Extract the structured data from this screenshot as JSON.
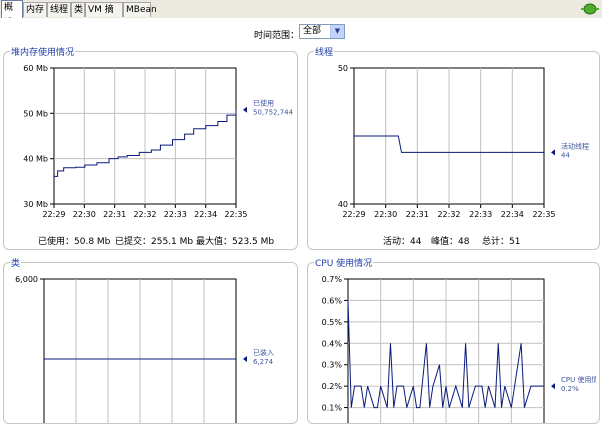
{
  "tabs": [
    {
      "label": "概述",
      "active": true
    },
    {
      "label": "内存"
    },
    {
      "label": "线程"
    },
    {
      "label": "类"
    },
    {
      "label": "VM 摘要"
    },
    {
      "label": "MBean"
    }
  ],
  "time_range": {
    "label": "时间范围：",
    "value": "全部"
  },
  "panels": {
    "heap": {
      "title": "堆内存使用情况",
      "legend": [
        "已使用",
        "50,752,744"
      ],
      "footer": {
        "used": "已使用：50.8 Mb",
        "committed": "已提交：255.1 Mb",
        "max": "最大值：523.5 Mb"
      }
    },
    "threads": {
      "title": "线程",
      "legend": [
        "活动线程",
        "44"
      ],
      "footer": {
        "live": "活动：44",
        "peak": "峰值：48",
        "total": "总计：51"
      }
    },
    "classes": {
      "title": "类",
      "legend": [
        "已装入",
        "6,274"
      ]
    },
    "cpu": {
      "title": "CPU 使用情况",
      "legend": [
        "CPU 使用情况",
        "0.2%"
      ]
    }
  },
  "colors": {
    "series": "#0a1a7a",
    "grid": "#c0c0c0",
    "title": "#1f3da8"
  },
  "chart_data": [
    {
      "type": "line",
      "title": "堆内存使用情况",
      "x": [
        "22:29",
        "22:30",
        "22:31",
        "22:32",
        "22:33",
        "22:34",
        "22:35"
      ],
      "yticks": [
        "30 Mb",
        "40 Mb",
        "50 Mb",
        "60 Mb"
      ],
      "ylim": [
        30,
        60
      ],
      "xlim": [
        22.48,
        28.5
      ],
      "series": [
        {
          "name": "已使用",
          "points": [
            [
              22.48,
              36.1
            ],
            [
              22.6,
              37.3
            ],
            [
              22.8,
              38.0
            ],
            [
              23.2,
              38.1
            ],
            [
              23.5,
              38.6
            ],
            [
              23.9,
              39.1
            ],
            [
              24.3,
              40.0
            ],
            [
              24.6,
              40.4
            ],
            [
              24.9,
              40.7
            ],
            [
              25.3,
              41.4
            ],
            [
              25.7,
              41.9
            ],
            [
              26.0,
              43.0
            ],
            [
              26.4,
              44.2
            ],
            [
              26.8,
              45.4
            ],
            [
              27.1,
              46.6
            ],
            [
              27.5,
              47.3
            ],
            [
              27.9,
              48.2
            ],
            [
              28.2,
              49.6
            ],
            [
              28.5,
              50.8
            ]
          ]
        }
      ]
    },
    {
      "type": "line",
      "title": "线程",
      "x": [
        "22:29",
        "22:30",
        "22:31",
        "22:32",
        "22:33",
        "22:34",
        "22:35"
      ],
      "yticks": [
        "40",
        "50"
      ],
      "ylim": [
        40,
        50
      ],
      "xlim": [
        22.5,
        28.5
      ],
      "series": [
        {
          "name": "活动线程",
          "points": [
            [
              22.5,
              45.0
            ],
            [
              23.9,
              45.0
            ],
            [
              24.0,
              43.8
            ],
            [
              28.5,
              43.8
            ]
          ]
        }
      ]
    },
    {
      "type": "line",
      "title": "类",
      "yticks": [
        "6,000"
      ],
      "ylim": [
        0,
        6000
      ],
      "xlim": [
        22.5,
        28.5
      ],
      "series": [
        {
          "name": "已装入",
          "points": [
            [
              22.5,
              2800
            ],
            [
              28.5,
              2800
            ]
          ]
        }
      ]
    },
    {
      "type": "line",
      "title": "CPU 使用情况",
      "yticks": [
        "0.1%",
        "0.2%",
        "0.3%",
        "0.4%",
        "0.5%",
        "0.6%",
        "0.7%"
      ],
      "ylim": [
        0,
        0.7
      ],
      "xlim": [
        22.5,
        28.5
      ],
      "series": [
        {
          "name": "CPU 使用情况",
          "points": [
            [
              22.5,
              0.6
            ],
            [
              22.6,
              0.1
            ],
            [
              22.7,
              0.2
            ],
            [
              22.9,
              0.2
            ],
            [
              23.0,
              0.1
            ],
            [
              23.1,
              0.2
            ],
            [
              23.3,
              0.1
            ],
            [
              23.4,
              0.1
            ],
            [
              23.5,
              0.2
            ],
            [
              23.7,
              0.1
            ],
            [
              23.8,
              0.4
            ],
            [
              23.9,
              0.1
            ],
            [
              24.0,
              0.2
            ],
            [
              24.2,
              0.2
            ],
            [
              24.3,
              0.1
            ],
            [
              24.5,
              0.2
            ],
            [
              24.6,
              0.1
            ],
            [
              24.7,
              0.1
            ],
            [
              24.9,
              0.4
            ],
            [
              25.0,
              0.1
            ],
            [
              25.1,
              0.2
            ],
            [
              25.3,
              0.3
            ],
            [
              25.4,
              0.1
            ],
            [
              25.5,
              0.2
            ],
            [
              25.6,
              0.1
            ],
            [
              25.8,
              0.2
            ],
            [
              26.0,
              0.1
            ],
            [
              26.1,
              0.4
            ],
            [
              26.2,
              0.1
            ],
            [
              26.4,
              0.2
            ],
            [
              26.6,
              0.2
            ],
            [
              26.7,
              0.1
            ],
            [
              26.8,
              0.2
            ],
            [
              27.0,
              0.1
            ],
            [
              27.1,
              0.4
            ],
            [
              27.2,
              0.1
            ],
            [
              27.3,
              0.2
            ],
            [
              27.5,
              0.1
            ],
            [
              27.6,
              0.2
            ],
            [
              27.8,
              0.4
            ],
            [
              27.9,
              0.1
            ],
            [
              28.1,
              0.2
            ],
            [
              28.3,
              0.2
            ],
            [
              28.5,
              0.2
            ]
          ]
        }
      ]
    }
  ]
}
